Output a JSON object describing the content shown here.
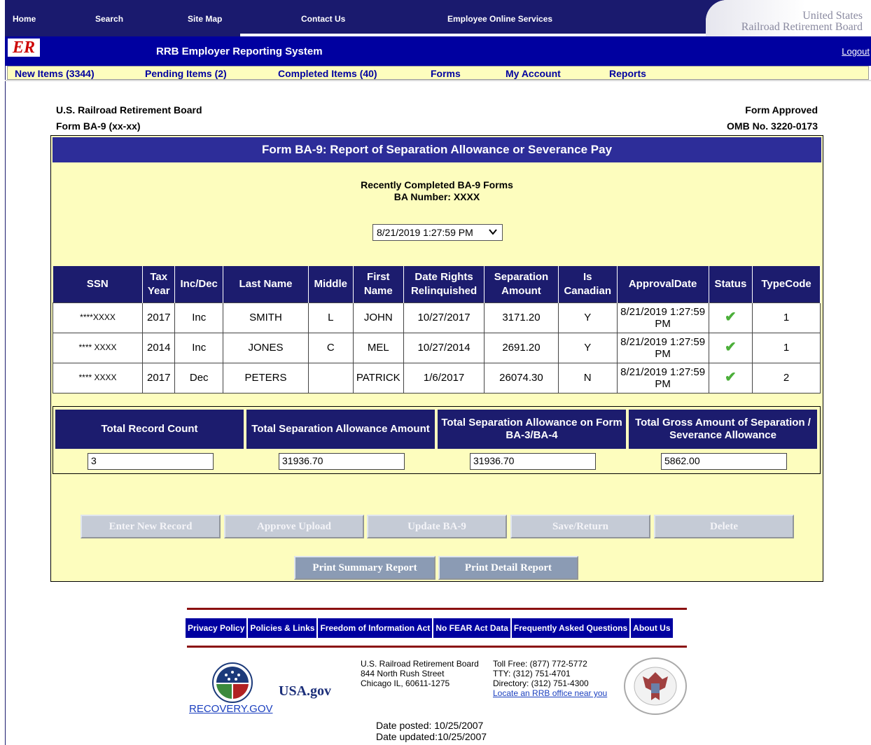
{
  "topnav": {
    "items": [
      "Home",
      "Search",
      "Site Map",
      "Contact Us",
      "Employee Online Services"
    ],
    "agency_line1": "United States",
    "agency_line2": "Railroad Retirement Board"
  },
  "sysbar": {
    "logo_text": "ER",
    "title": "RRB Employer Reporting System",
    "logout": "Logout"
  },
  "menu": {
    "items": [
      "New Items (3344)",
      "Pending Items (2)",
      "Completed Items (40)",
      "Forms",
      "My Account",
      "Reports"
    ]
  },
  "header": {
    "org": "U.S. Railroad Retirement Board",
    "form_id": "Form BA-9 (xx-xx)",
    "approved": "Form Approved",
    "omb": "OMB No. 3220-0173"
  },
  "form": {
    "title": "Form BA-9: Report of Separation Allowance or Severance Pay",
    "recent_label": "Recently Completed BA-9 Forms",
    "ba_label": "BA Number:",
    "ba_value": "XXXX",
    "selected_date": "8/21/2019 1:27:59 PM"
  },
  "table": {
    "headers": [
      "SSN",
      "Tax Year",
      "Inc/Dec",
      "Last Name",
      "Middle",
      "First Name",
      "Date Rights Relinquished",
      "Separation Amount",
      "Is Canadian",
      "ApprovalDate",
      "Status",
      "TypeCode"
    ],
    "rows": [
      [
        "****XXXX",
        "2017",
        "Inc",
        "SMITH",
        "L",
        "JOHN",
        "10/27/2017",
        "3171.20",
        "Y",
        "8/21/2019 1:27:59 PM",
        "✔",
        "1"
      ],
      [
        "**** XXXX",
        "2014",
        "Inc",
        "JONES",
        "C",
        "MEL",
        "10/27/2014",
        "2691.20",
        "Y",
        "8/21/2019 1:27:59 PM",
        "✔",
        "1"
      ],
      [
        "**** XXXX",
        "2017",
        "Dec",
        "PETERS",
        "",
        "PATRICK",
        "1/6/2017",
        "26074.30",
        "N",
        "8/21/2019 1:27:59 PM",
        "✔",
        "2"
      ]
    ]
  },
  "totals": {
    "headers": [
      "Total Record Count",
      "Total Separation Allowance Amount",
      "Total Separation Allowance on Form BA-3/BA-4",
      "Total Gross Amount of Separation / Severance Allowance"
    ],
    "values": [
      "3",
      "31936.70",
      "31936.70",
      "5862.00"
    ]
  },
  "buttons": {
    "enter_new": "Enter New Record",
    "approve_upload": "Approve Upload",
    "update": "Update BA-9",
    "save_return": "Save/Return",
    "delete": "Delete",
    "print_summary": "Print Summary Report",
    "print_detail": "Print Detail Report"
  },
  "footer": {
    "links": [
      "Privacy Policy",
      "Policies & Links",
      "Freedom of Information Act",
      "No FEAR Act Data",
      "Frequently Asked Questions",
      "About Us"
    ],
    "recovery": "RECOVERY.GOV",
    "usa_gov": "USA.gov",
    "address": [
      "U.S. Railroad Retirement Board",
      "844 North Rush Street",
      "Chicago IL, 60611-1275"
    ],
    "contact": [
      "Toll Free: (877) 772-5772",
      "TTY: (312) 751-4701",
      "Directory: (312) 751-4300"
    ],
    "locate_link": "Locate an RRB office near you",
    "posted": "Date posted: 10/25/2007",
    "updated": "Date updated:10/25/2007"
  },
  "colors": {
    "nav_blue": "#1a1a6e",
    "system_blue": "#0000a0",
    "form_yellow": "#fdfdbe",
    "status_green": "#4caf3a",
    "footer_red": "#8b1010"
  }
}
